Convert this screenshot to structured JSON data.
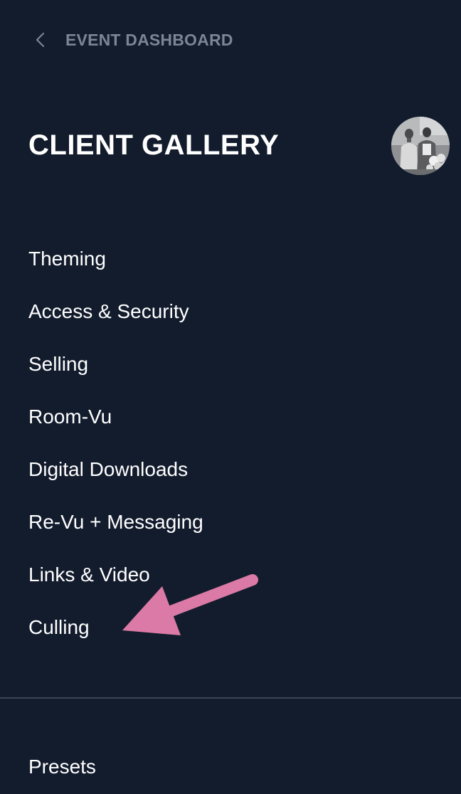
{
  "header": {
    "back_label": "EVENT DASHBOARD",
    "back_icon": "chevron-left-icon"
  },
  "gallery": {
    "title": "CLIENT GALLERY",
    "avatar": "avatar-photo"
  },
  "menu": {
    "items": [
      {
        "label": "Theming"
      },
      {
        "label": "Access & Security"
      },
      {
        "label": "Selling"
      },
      {
        "label": "Room-Vu"
      },
      {
        "label": "Digital Downloads"
      },
      {
        "label": "Re-Vu + Messaging"
      },
      {
        "label": "Links & Video"
      },
      {
        "label": "Culling"
      }
    ]
  },
  "footer": {
    "presets_label": "Presets"
  },
  "annotation": {
    "arrow_color": "#db7aa6",
    "points_to": "Culling"
  },
  "colors": {
    "background": "#131c2d",
    "text": "#ffffff",
    "muted_text": "#7b8596",
    "divider": "#3a4457"
  }
}
